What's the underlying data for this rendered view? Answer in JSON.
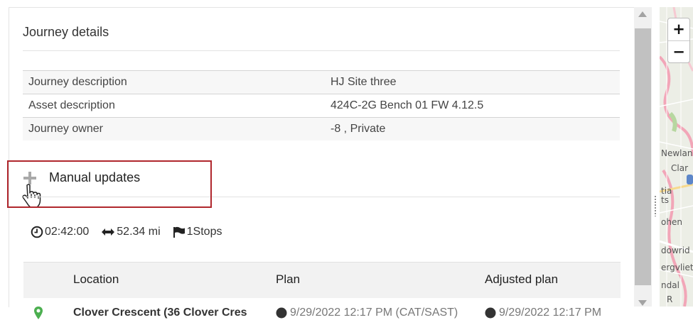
{
  "journey_details": {
    "title": "Journey details",
    "rows": [
      {
        "label": "Journey description",
        "value": "HJ Site three"
      },
      {
        "label": "Asset description",
        "value": "424C-2G Bench 01 FW 4.12.5"
      },
      {
        "label": "Journey owner",
        "value": "-8 , Private"
      }
    ]
  },
  "manual_updates": {
    "label": "Manual updates",
    "icon": "plus-icon",
    "cursor": "hand-pointer-icon"
  },
  "stats": {
    "duration": "02:42:00",
    "distance": "52.34 mi",
    "stops": "1Stops"
  },
  "stops_table": {
    "headers": [
      "Location",
      "Plan",
      "Adjusted plan"
    ],
    "rows": [
      {
        "location": "Clover Crescent (36 Clover Cres",
        "plan": "9/29/2022 12:17 PM (CAT/SAST)",
        "adjusted": "9/29/2022 12:17 PM"
      }
    ]
  },
  "map": {
    "zoom_in": "+",
    "zoom_out": "−",
    "labels": [
      "Newlands",
      "Clar",
      "tia",
      "ts",
      "ohen",
      "dowrid",
      "ergvliet",
      "ndal",
      "R"
    ]
  },
  "colors": {
    "highlight": "#b0272d",
    "pin": "#4caf50"
  }
}
